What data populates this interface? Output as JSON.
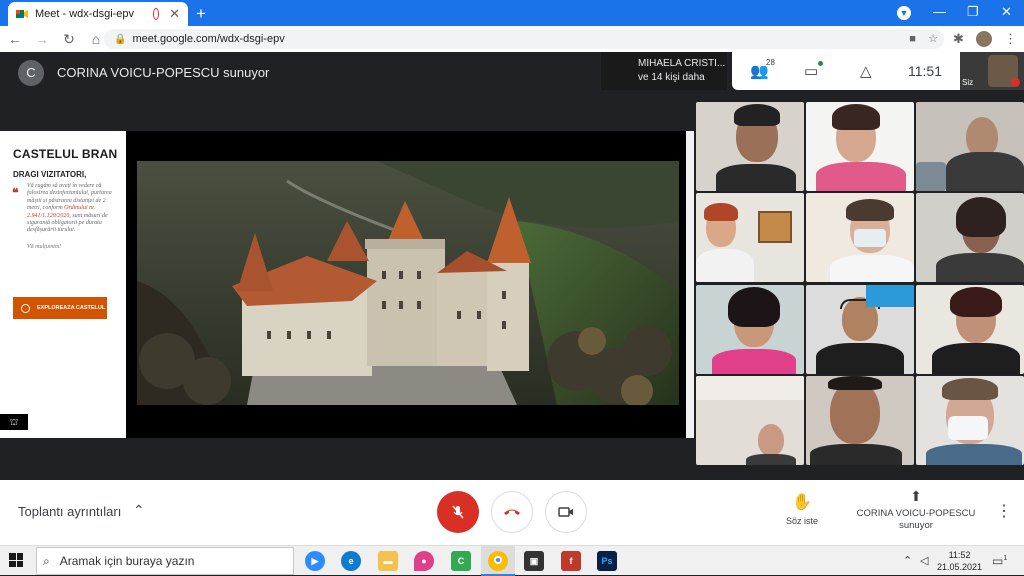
{
  "browser": {
    "tabs": [
      {
        "title": "Meet - wdx-dsgi-epv",
        "close": "✕"
      },
      {
        "title": "",
        "close": "✕"
      }
    ],
    "new_tab": "+",
    "window_controls": [
      "—",
      "❐",
      "✕"
    ],
    "url": "meet.google.com/wdx-dsgi-epv"
  },
  "meet": {
    "presenter_initial": "C",
    "presenter_title": "CORINA VOICU-POPESCU sunuyor",
    "participant_name": "MIHAELA CRISTI...",
    "participant_more": "ve 14 kişi daha",
    "people_count": "28",
    "time": "11:51",
    "self_label": "Siz"
  },
  "slide": {
    "title": "CASTELUL BRAN",
    "greeting": "DRAGI VIZITATORI,",
    "message_pre": "Vă rugăm să aveți în vedere că folosirea dezinfectantului, purtarea măștii și păstrarea distanței de 2 metri, conform ",
    "message_link": "Ordinului nr. 2.941/1.120/2020",
    "message_post": ", sunt măsuri de siguranță obligatorii pe durata desfășurării turului.",
    "thanks": "Vă mulțumim!",
    "button": "EXPLOREAZA CASTELUL"
  },
  "bottom": {
    "meeting_details": "Toplantı ayrıntıları",
    "raise_hand": "Söz iste",
    "presenting_name": "CORINA VOICU-POPESCU",
    "presenting_label": "sunuyor"
  },
  "taskbar": {
    "search_placeholder": "Aramak için buraya yazın",
    "time": "11:52",
    "date": "21.05.2021",
    "notifications": "1"
  }
}
